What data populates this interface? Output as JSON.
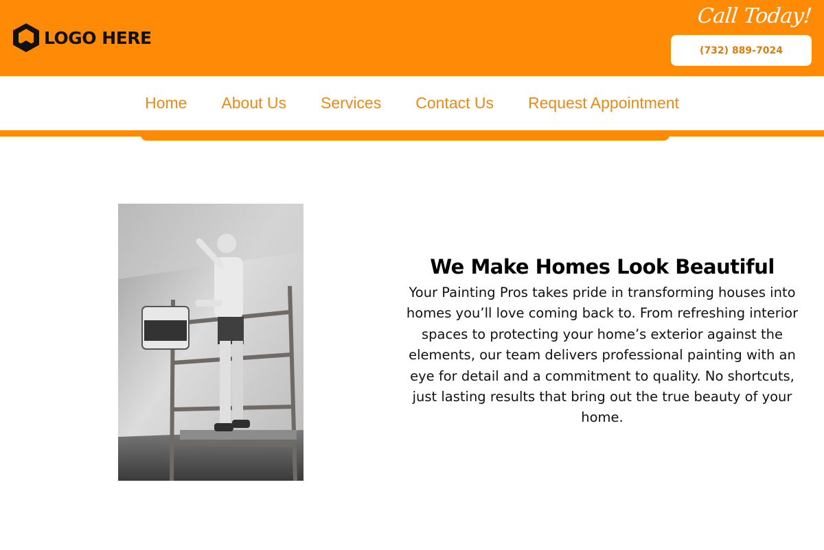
{
  "header": {
    "logo_text": "LOGO HERE",
    "logo_icon": "hexagon-logo-icon",
    "cta_title": "Call Today!",
    "phone": "(732) 889-7024"
  },
  "nav": {
    "items": [
      {
        "label": "Home"
      },
      {
        "label": "About Us"
      },
      {
        "label": "Services"
      },
      {
        "label": "Contact Us"
      },
      {
        "label": "Request Appointment"
      }
    ]
  },
  "main": {
    "heading": "We Make Homes Look Beautiful",
    "body": "Your Painting Pros takes pride in transforming houses into homes you’ll love coming back to. From refreshing interior spaces to protecting your home’s exterior against the elements, our team delivers professional painting with an eye for detail and a commitment to quality. No shortcuts, just lasting results that bring out the true beauty of your home.",
    "image_alt": "painter-on-scaffold-photo"
  },
  "colors": {
    "brand_orange": "#ff8a05",
    "nav_text": "#e98a16",
    "white": "#ffffff"
  }
}
